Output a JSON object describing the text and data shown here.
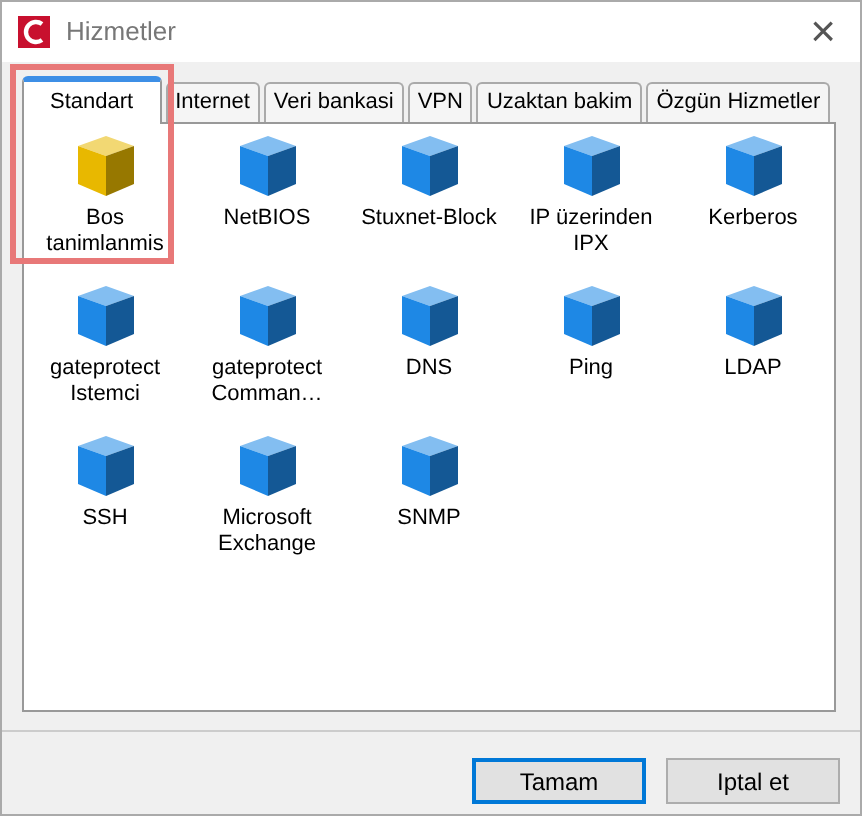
{
  "window": {
    "title": "Hizmetler",
    "close": "×"
  },
  "tabs": [
    {
      "label": "Standart",
      "selected": true
    },
    {
      "label": "Internet",
      "selected": false
    },
    {
      "label": "Veri bankasi",
      "selected": false
    },
    {
      "label": "VPN",
      "selected": false
    },
    {
      "label": "Uzaktan bakim",
      "selected": false
    },
    {
      "label": "Özgün Hizmetler",
      "selected": false
    }
  ],
  "annotation_box": true,
  "services": [
    {
      "label": "Bos tanimlanmis",
      "color": "#e8b800"
    },
    {
      "label": "NetBIOS",
      "color": "#1e88e5"
    },
    {
      "label": "Stuxnet-Block",
      "color": "#1e88e5"
    },
    {
      "label": "IP üzerinden IPX",
      "color": "#1e88e5"
    },
    {
      "label": "Kerberos",
      "color": "#1e88e5"
    },
    {
      "label": "gateprotect Istemci",
      "color": "#1e88e5"
    },
    {
      "label": "gateprotect Comman…",
      "color": "#1e88e5"
    },
    {
      "label": "DNS",
      "color": "#1e88e5"
    },
    {
      "label": "Ping",
      "color": "#1e88e5"
    },
    {
      "label": "LDAP",
      "color": "#1e88e5"
    },
    {
      "label": "SSH",
      "color": "#1e88e5"
    },
    {
      "label": "Microsoft Exchange",
      "color": "#1e88e5"
    },
    {
      "label": "SNMP",
      "color": "#1e88e5"
    }
  ],
  "buttons": [
    {
      "label": "Tamam",
      "default": true
    },
    {
      "label": "Iptal et",
      "default": false
    }
  ]
}
